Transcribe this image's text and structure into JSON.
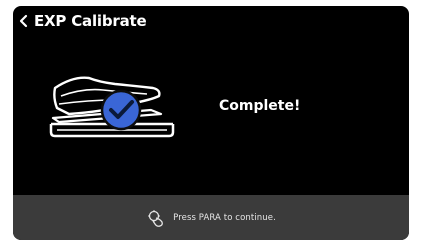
{
  "header": {
    "back_icon": "chevron-left-icon",
    "title": "EXP Calibrate"
  },
  "main": {
    "illustration_icon": "expression-pedal-check-icon",
    "status_text": "Complete!"
  },
  "footer": {
    "hint_icon": "hand-knob-icon",
    "hint_text": "Press PARA to continue."
  },
  "colors": {
    "background": "#000000",
    "footer_bg": "#3b3b3b",
    "accent_blue": "#3a66d6",
    "text": "#ffffff"
  }
}
